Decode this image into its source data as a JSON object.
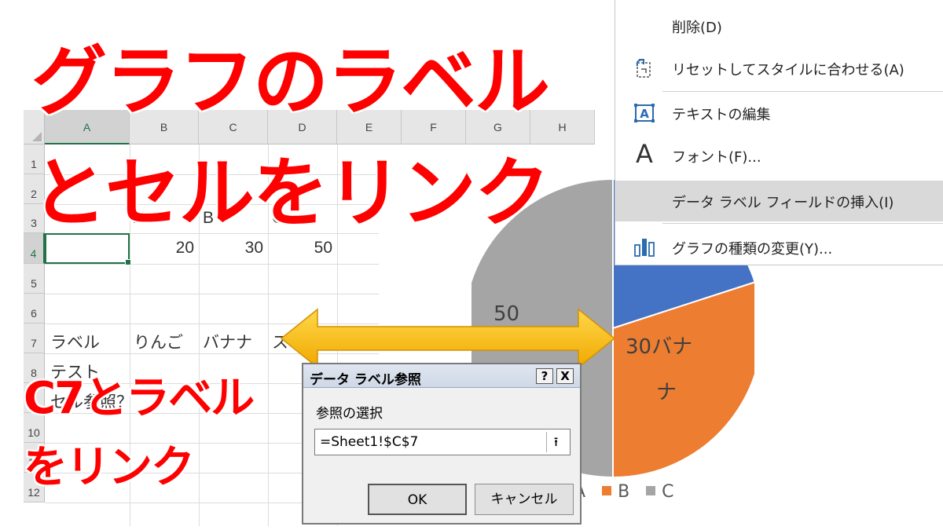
{
  "sheet": {
    "columns": [
      "A",
      "B",
      "C",
      "D",
      "E",
      "F",
      "G",
      "H"
    ],
    "rows": [
      "1",
      "2",
      "3",
      "4",
      "5",
      "6",
      "7",
      "8",
      "9",
      "10",
      "11",
      "12"
    ],
    "cells": {
      "b3": "A",
      "c3": "B",
      "d3": "C",
      "b4": "20",
      "c4": "30",
      "d4": "50",
      "a7": "ラベル",
      "b7": "りんご",
      "c7": "バナナ",
      "d7": "ス",
      "a8": "テスト",
      "a9": "セル参照？"
    }
  },
  "title": {
    "line1": "グラフのラベル",
    "line2": "とセルをリンク"
  },
  "subtitle": {
    "line1": "C7とラベル",
    "line2": "をリンク"
  },
  "context_menu": {
    "items": [
      {
        "label": "削除(D)",
        "icon": "none"
      },
      {
        "label": "リセットしてスタイルに合わせる(A)",
        "icon": "reset-style-icon"
      },
      {
        "label": "テキストの編集",
        "icon": "edit-text-icon"
      },
      {
        "label": "フォント(F)...",
        "icon": "font-icon"
      },
      {
        "label": "データ ラベル フィールドの挿入(I)",
        "icon": "none",
        "highlighted": true
      },
      {
        "label": "グラフの種類の変更(Y)...",
        "icon": "chart-type-icon"
      }
    ],
    "font_glyph": "A",
    "edit_glyph": "A"
  },
  "chart": {
    "label_c": "50",
    "label_b": "30バナ\nナ",
    "label_b1": "30バナ",
    "label_b2": "ナ",
    "colors": {
      "A": "#4472c4",
      "B": "#ed7d31",
      "C": "#a5a5a5"
    },
    "legend": [
      {
        "name": "A",
        "color": "#4472c4"
      },
      {
        "name": "B",
        "color": "#ed7d31"
      },
      {
        "name": "C",
        "color": "#a5a5a5"
      }
    ]
  },
  "chart_data": {
    "type": "pie",
    "categories": [
      "A",
      "B",
      "C"
    ],
    "values": [
      20,
      30,
      50
    ],
    "data_labels": [
      "",
      "30バナナ",
      "50"
    ]
  },
  "dialog": {
    "title": "データ ラベル参照",
    "help_btn": "?",
    "close_btn": "X",
    "label": "参照の選択",
    "input_value": "=Sheet1!$C$7",
    "collapse_glyph": "⭱",
    "ok": "OK",
    "cancel": "キャンセル"
  },
  "arrow_color": "#f5c000"
}
